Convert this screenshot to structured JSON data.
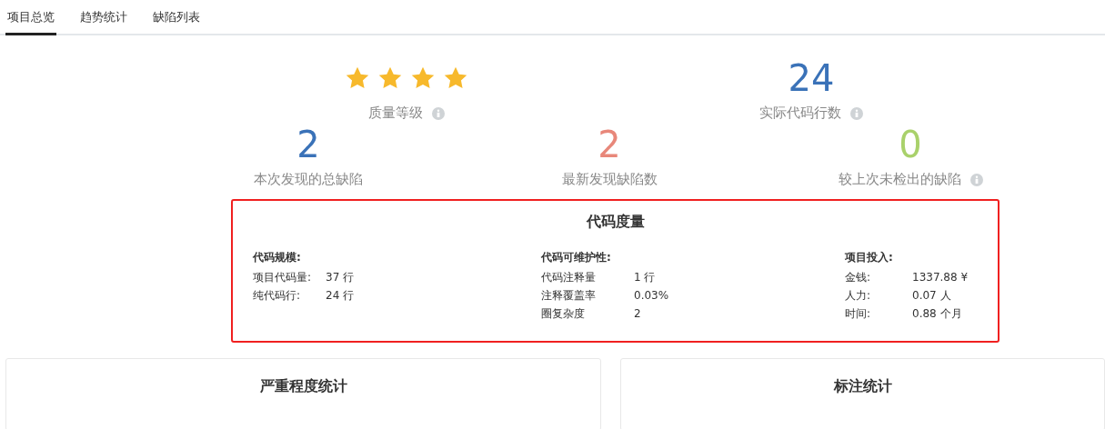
{
  "tabs": [
    {
      "label": "项目总览",
      "selected": true
    },
    {
      "label": "趋势统计",
      "selected": false
    },
    {
      "label": "缺陷列表",
      "selected": false
    }
  ],
  "summary_top": [
    {
      "kind": "stars",
      "stars": 4,
      "label": "质量等级",
      "info": true
    },
    {
      "kind": "number",
      "value": "24",
      "color": "#3a72b8",
      "label": "实际代码行数",
      "info": true
    }
  ],
  "summary_bottom": [
    {
      "value": "2",
      "color": "#3a72b8",
      "label": "本次发现的总缺陷",
      "info": false
    },
    {
      "value": "2",
      "color": "#e8877a",
      "label": "最新发现缺陷数",
      "info": false
    },
    {
      "value": "0",
      "color": "#a9d16b",
      "label": "较上次未检出的缺陷",
      "info": true
    }
  ],
  "metrics": {
    "title": "代码度量",
    "groups": [
      {
        "title": "代码规模:",
        "rows": [
          {
            "label": "项目代码量:",
            "value": "37 行"
          },
          {
            "label": "纯代码行:",
            "value": "24 行"
          }
        ]
      },
      {
        "title": "代码可维护性:",
        "rows": [
          {
            "label": "代码注释量",
            "value": "1 行"
          },
          {
            "label": "注释覆盖率",
            "value": "0.03%"
          },
          {
            "label": "圈复杂度",
            "value": "2"
          }
        ]
      },
      {
        "title": "项目投入:",
        "rows": [
          {
            "label": "金钱:",
            "value": "1337.88 ¥"
          },
          {
            "label": "人力:",
            "value": "0.07 人"
          },
          {
            "label": "时间:",
            "value": "0.88 个月"
          }
        ]
      }
    ]
  },
  "cards": [
    {
      "title": "严重程度统计"
    },
    {
      "title": "标注统计"
    }
  ]
}
